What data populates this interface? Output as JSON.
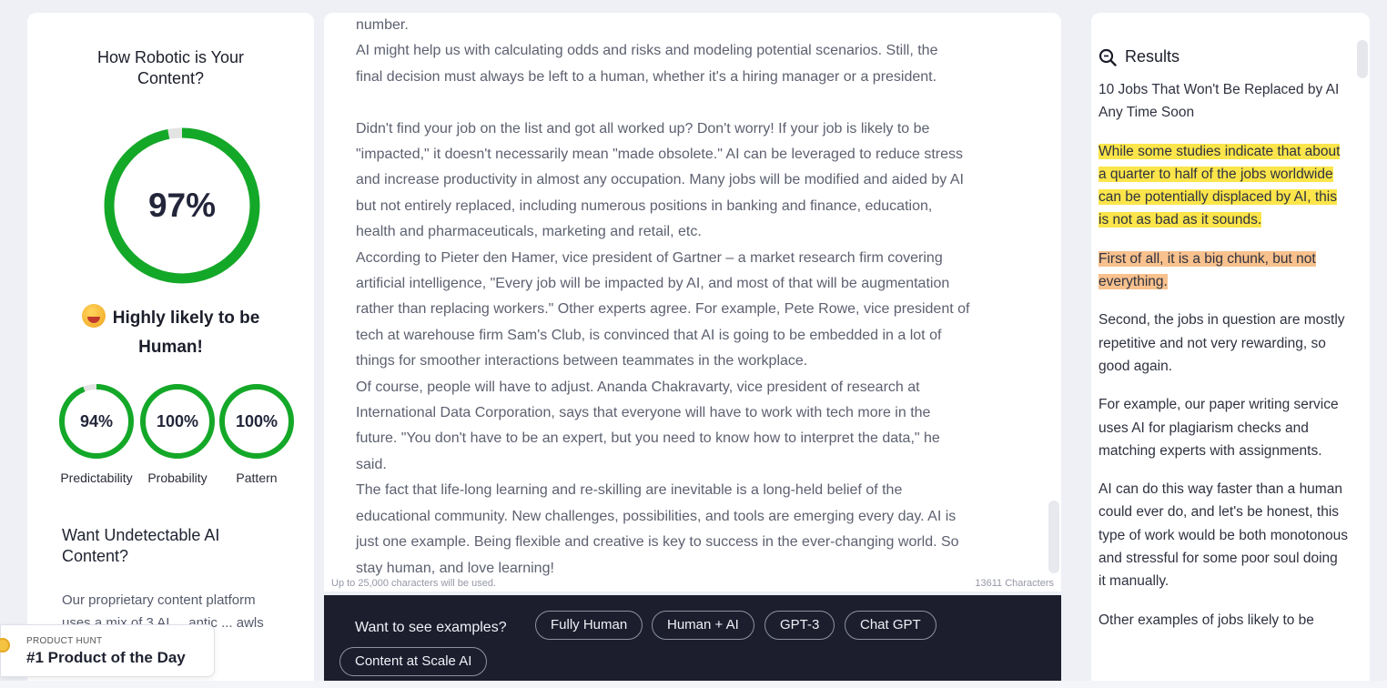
{
  "detector": {
    "title": "How Robotic is Your Content?",
    "score": "97%",
    "score_fraction": 0.97,
    "verdict_line1": "Highly likely to be",
    "verdict_line2": "Human!",
    "ring_color": "#14a828",
    "ring_track": "#e3e3e3",
    "metrics": [
      {
        "value": "94%",
        "fraction": 0.94,
        "label": "Predictability"
      },
      {
        "value": "100%",
        "fraction": 1.0,
        "label": "Probability"
      },
      {
        "value": "100%",
        "fraction": 1.0,
        "label": "Pattern"
      }
    ]
  },
  "promo": {
    "title": "Want Undetectable AI Content?",
    "text": "Our proprietary content platform uses a mix of 3 AI ... antic ... awls"
  },
  "product_hunt": {
    "small": "PRODUCT HUNT",
    "big": "#1 Product of the Day"
  },
  "article": {
    "lines": [
      "number.",
      "AI might help us with calculating odds and risks and modeling potential scenarios. Still, the",
      "final decision must always be left to a human, whether it's a hiring manager or a president.",
      "",
      "Didn't find your job on the list and got all worked up? Don't worry! If your job is likely to be",
      "\"impacted,\" it doesn't necessarily mean \"made obsolete.\" AI can be leveraged to reduce stress",
      "and increase productivity in almost any occupation. Many jobs will be modified and aided by AI",
      "but not entirely replaced, including numerous positions in banking and finance, education,",
      "health and pharmaceuticals, marketing and retail, etc.",
      "According to Pieter den Hamer, vice president of Gartner – a market research firm covering",
      "artificial intelligence, \"Every job will be impacted by AI, and most of that will be augmentation",
      "rather than replacing workers.\" Other experts agree. For example, Pete Rowe, vice president of",
      "tech at warehouse firm Sam's Club, is convinced that AI is going to be embedded in a lot of",
      "things for smoother interactions between teammates in the workplace.",
      "Of course, people will have to adjust. Ananda Chakravarty, vice president of research at",
      "International Data Corporation, says that everyone will have to work with tech more in the",
      "future. \"You don't have to be an expert, but you need to know how to interpret the data,\" he",
      "said.",
      "The fact that life-long learning and re-skilling are inevitable is a long-held belief of the",
      "educational community. New challenges, possibilities, and tools are emerging every day. AI is",
      "just one example. Being flexible and creative is key to success in the ever-changing world. So",
      "stay human, and love learning!"
    ],
    "limit_note": "Up to 25,000 characters will be used.",
    "char_count": "13611 Characters"
  },
  "examples": {
    "question": "Want to see examples?",
    "chips": [
      "Fully Human",
      "Human + AI",
      "GPT-3",
      "Chat GPT",
      "Content at Scale AI"
    ]
  },
  "results": {
    "heading": "Results",
    "title": "10 Jobs That Won't Be Replaced by AI Any Time Soon",
    "seg1": "While some studies indicate that about a quarter to half of the jobs worldwide can be potentially displaced by AI, this is not as bad as it sounds.",
    "seg2": "First of all, it is a big chunk, but not everything.",
    "seg3": "Second, the jobs in question are mostly repetitive and not very rewarding, so good again.",
    "seg4": "For example, our paper writing service uses AI for plagiarism checks and matching experts with assignments.",
    "seg5": "AI can do this way faster than a human could ever do, and let's be honest, this type of work would be both monotonous and stressful for some poor soul doing it manually.",
    "seg6": "Other examples of jobs likely to be",
    "highlight_yellow": "#fbe54a",
    "highlight_orange": "#f8c18d"
  }
}
